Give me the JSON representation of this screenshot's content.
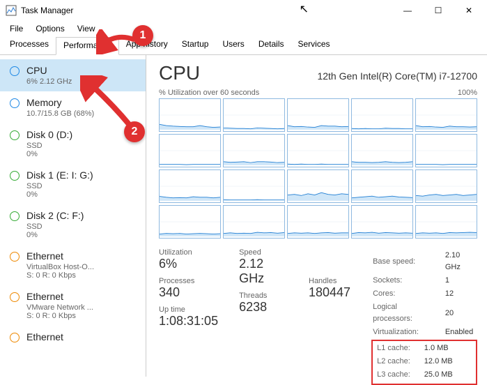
{
  "window": {
    "title": "Task Manager"
  },
  "menu": {
    "file": "File",
    "options": "Options",
    "view": "View"
  },
  "tabs": {
    "processes": "Processes",
    "performance": "Performance",
    "apphistory": "App history",
    "startup": "Startup",
    "users": "Users",
    "details": "Details",
    "services": "Services"
  },
  "sidebar": [
    {
      "name": "CPU",
      "sub": "6% 2.12 GHz",
      "color": "blue",
      "active": true
    },
    {
      "name": "Memory",
      "sub": "10.7/15.8 GB (68%)",
      "color": "blue"
    },
    {
      "name": "Disk 0 (D:)",
      "sub": "SSD\n0%",
      "color": "green"
    },
    {
      "name": "Disk 1 (E: I: G:)",
      "sub": "SSD\n0%",
      "color": "green"
    },
    {
      "name": "Disk 2 (C: F:)",
      "sub": "SSD\n0%",
      "color": "green"
    },
    {
      "name": "Ethernet",
      "sub": "VirtualBox Host-O...\nS: 0  R: 0 Kbps",
      "color": "orange"
    },
    {
      "name": "Ethernet",
      "sub": "VMware Network ...\nS: 0  R: 0 Kbps",
      "color": "orange"
    },
    {
      "name": "Ethernet",
      "sub": "",
      "color": "orange"
    }
  ],
  "main": {
    "title": "CPU",
    "model": "12th Gen Intel(R) Core(TM) i7-12700",
    "graph_label_left": "% Utilization over 60 seconds",
    "graph_label_right": "100%",
    "stats": {
      "utilization_label": "Utilization",
      "utilization": "6%",
      "speed_label": "Speed",
      "speed": "2.12 GHz",
      "processes_label": "Processes",
      "processes": "340",
      "threads_label": "Threads",
      "threads": "6238",
      "handles_label": "Handles",
      "handles": "180447",
      "uptime_label": "Up time",
      "uptime": "1:08:31:05"
    },
    "details": {
      "base_speed_l": "Base speed:",
      "base_speed": "2.10 GHz",
      "sockets_l": "Sockets:",
      "sockets": "1",
      "cores_l": "Cores:",
      "cores": "12",
      "lprocs_l": "Logical processors:",
      "lprocs": "20",
      "virt_l": "Virtualization:",
      "virt": "Enabled",
      "l1_l": "L1 cache:",
      "l1": "1.0 MB",
      "l2_l": "L2 cache:",
      "l2": "12.0 MB",
      "l3_l": "L3 cache:",
      "l3": "25.0 MB"
    }
  },
  "annotation": {
    "n1": "1",
    "n2": "2"
  },
  "chart_data": {
    "type": "area",
    "title": "CPU % Utilization over 60 seconds",
    "ylabel": "% Utilization",
    "ylim": [
      0,
      100
    ],
    "x_range_seconds": 60,
    "note": "20 logical-processor mini-graphs; approximate utilization read from sparkline heights",
    "series": [
      {
        "name": "LP0",
        "values": [
          18,
          14,
          12,
          11,
          10,
          10,
          14,
          10,
          8,
          9
        ]
      },
      {
        "name": "LP1",
        "values": [
          6,
          5,
          4,
          4,
          3,
          6,
          5,
          4,
          3,
          4
        ]
      },
      {
        "name": "LP2",
        "values": [
          14,
          10,
          11,
          9,
          8,
          14,
          12,
          12,
          10,
          11
        ]
      },
      {
        "name": "LP3",
        "values": [
          4,
          3,
          4,
          3,
          3,
          5,
          4,
          4,
          3,
          3
        ]
      },
      {
        "name": "LP4",
        "values": [
          14,
          10,
          11,
          9,
          8,
          12,
          10,
          10,
          9,
          10
        ]
      },
      {
        "name": "LP5",
        "values": [
          3,
          3,
          3,
          3,
          2,
          3,
          3,
          3,
          3,
          3
        ]
      },
      {
        "name": "LP6",
        "values": [
          12,
          10,
          11,
          12,
          9,
          12,
          12,
          11,
          9,
          10
        ]
      },
      {
        "name": "LP7",
        "values": [
          4,
          3,
          4,
          3,
          3,
          4,
          3,
          3,
          3,
          3
        ]
      },
      {
        "name": "LP8",
        "values": [
          12,
          10,
          10,
          9,
          10,
          12,
          10,
          9,
          10,
          12
        ]
      },
      {
        "name": "LP9",
        "values": [
          3,
          3,
          3,
          3,
          2,
          3,
          3,
          3,
          3,
          3
        ]
      },
      {
        "name": "LP10",
        "values": [
          15,
          12,
          10,
          11,
          10,
          14,
          12,
          12,
          10,
          12
        ]
      },
      {
        "name": "LP11",
        "values": [
          4,
          3,
          3,
          3,
          3,
          4,
          3,
          3,
          3,
          3
        ]
      },
      {
        "name": "LP12",
        "values": [
          20,
          22,
          18,
          24,
          20,
          28,
          22,
          20,
          24,
          22
        ]
      },
      {
        "name": "LP13",
        "values": [
          10,
          12,
          14,
          16,
          12,
          14,
          16,
          13,
          12,
          11
        ]
      },
      {
        "name": "LP14",
        "values": [
          18,
          16,
          20,
          22,
          18,
          20,
          22,
          18,
          20,
          22
        ]
      },
      {
        "name": "LP15",
        "values": [
          8,
          10,
          9,
          10,
          8,
          9,
          10,
          9,
          8,
          9
        ]
      },
      {
        "name": "LP16",
        "values": [
          10,
          12,
          10,
          11,
          10,
          14,
          12,
          13,
          11,
          13
        ]
      },
      {
        "name": "LP17",
        "values": [
          10,
          12,
          11,
          12,
          10,
          12,
          13,
          11,
          12,
          12
        ]
      },
      {
        "name": "LP18",
        "values": [
          10,
          13,
          12,
          14,
          11,
          13,
          12,
          11,
          12,
          11
        ]
      },
      {
        "name": "LP19",
        "values": [
          10,
          12,
          11,
          12,
          10,
          13,
          12,
          13,
          14,
          13
        ]
      }
    ]
  }
}
